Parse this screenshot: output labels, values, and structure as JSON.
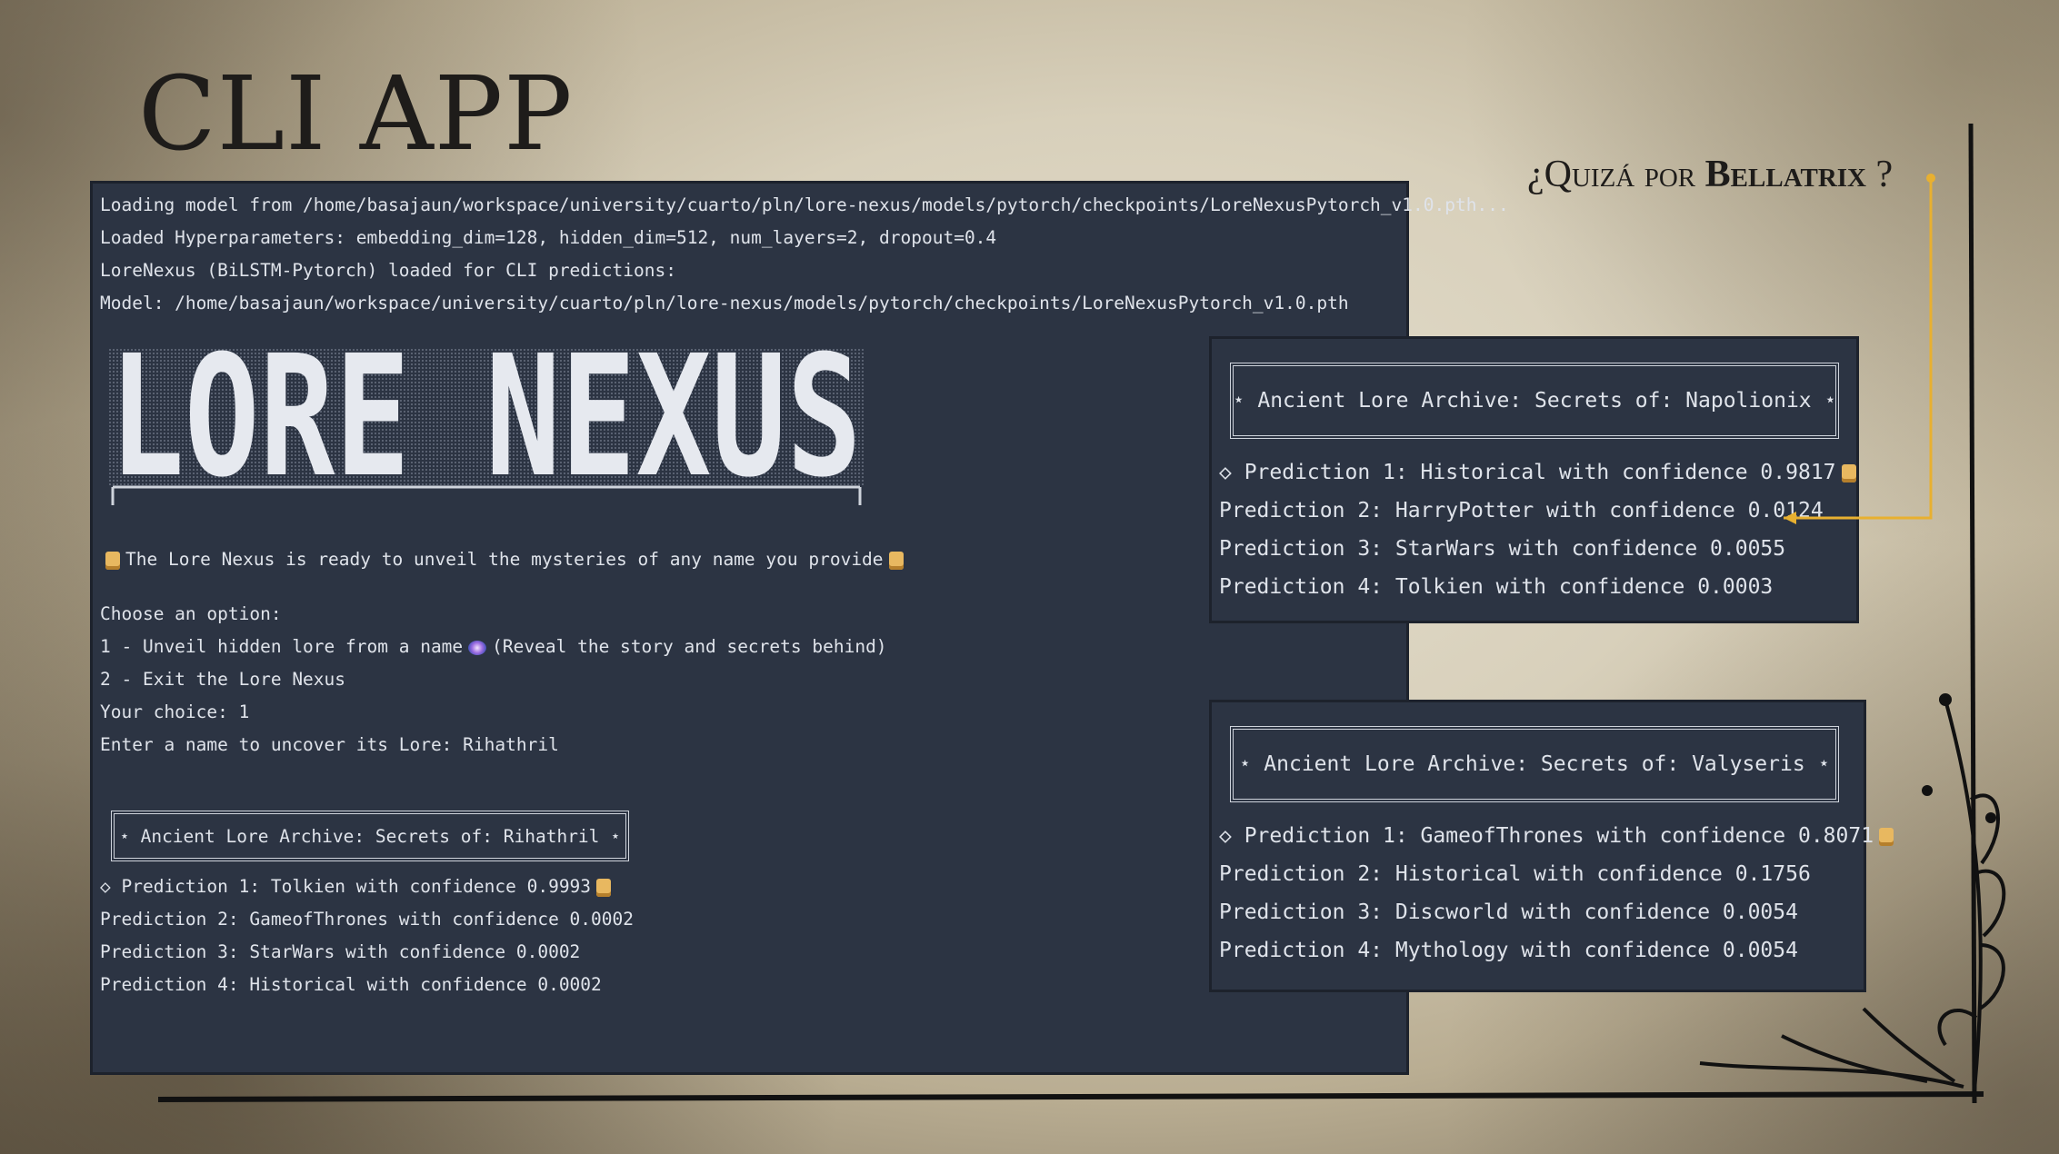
{
  "slide": {
    "title": "CLI APP",
    "subtitle_prefix": "¿Quizá por ",
    "subtitle_name": "Bellatrix",
    "subtitle_suffix": " ?",
    "accent_color": "#e8b030"
  },
  "terminal_main": {
    "log_lines": [
      "Loading model from /home/basajaun/workspace/university/cuarto/pln/lore-nexus/models/pytorch/checkpoints/LoreNexusPytorch_v1.0.pth...",
      "Loaded Hyperparameters: embedding_dim=128, hidden_dim=512, num_layers=2, dropout=0.4",
      "LoreNexus (BiLSTM-Pytorch) loaded for CLI predictions:",
      "Model: /home/basajaun/workspace/university/cuarto/pln/lore-nexus/models/pytorch/checkpoints/LoreNexusPytorch_v1.0.pth"
    ],
    "banner_text": "LORE NEXUS",
    "ready_message": "The Lore Nexus is ready to unveil the mysteries of any name you provide",
    "menu_title": "Choose an option:",
    "option_1_pre": "1 - Unveil hidden lore from a name",
    "option_1_post": "(Reveal the story and secrets behind)",
    "option_2": "2 - Exit the Lore Nexus",
    "choice_line": "Your choice: 1",
    "name_prompt": "Enter a name to uncover its Lore: Rihathril",
    "archive_title": "⋆ Ancient Lore Archive: Secrets of: Rihathril ⋆",
    "predictions": [
      "◇ Prediction 1: Tolkien with confidence 0.9993",
      "Prediction 2: GameofThrones with confidence 0.0002",
      "Prediction 3: StarWars with confidence 0.0002",
      "Prediction 4: Historical with confidence 0.0002"
    ]
  },
  "terminal_napolionix": {
    "archive_title": "⋆ Ancient Lore Archive: Secrets of: Napolionix ⋆",
    "predictions": [
      "◇ Prediction 1: Historical with confidence 0.9817",
      "Prediction 2: HarryPotter with confidence 0.0124",
      "Prediction 3: StarWars with confidence 0.0055",
      "Prediction 4: Tolkien with confidence 0.0003"
    ]
  },
  "terminal_valyseris": {
    "archive_title": "⋆ Ancient Lore Archive: Secrets of: Valyseris ⋆",
    "predictions": [
      "◇ Prediction 1: GameofThrones with confidence 0.8071",
      "Prediction 2: Historical with confidence 0.1756",
      "Prediction 3: Discworld with confidence 0.0054",
      "Prediction 4: Mythology with confidence 0.0054"
    ]
  }
}
